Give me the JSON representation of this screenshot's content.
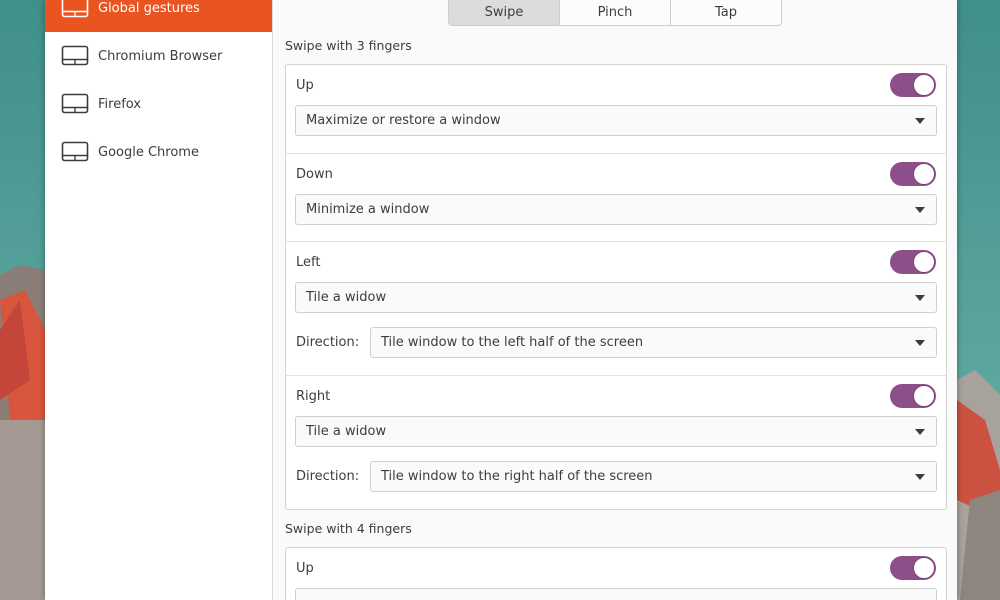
{
  "sidebar": {
    "items": [
      {
        "label": "Global gestures",
        "icon": "touchpad-icon",
        "active": true
      },
      {
        "label": "Chromium Browser",
        "icon": "touchpad-icon",
        "active": false
      },
      {
        "label": "Firefox",
        "icon": "touchpad-icon",
        "active": false
      },
      {
        "label": "Google Chrome",
        "icon": "touchpad-icon",
        "active": false
      }
    ]
  },
  "tabs": [
    {
      "label": "Swipe",
      "active": true
    },
    {
      "label": "Pinch",
      "active": false
    },
    {
      "label": "Tap",
      "active": false
    }
  ],
  "swipe3": {
    "title": "Swipe with 3 fingers",
    "gestures": [
      {
        "label": "Up",
        "enabled": true,
        "action": "Maximize or restore a window"
      },
      {
        "label": "Down",
        "enabled": true,
        "action": "Minimize a window"
      },
      {
        "label": "Left",
        "enabled": true,
        "action": "Tile a widow",
        "direction_label": "Direction:",
        "direction": "Tile window to the left half of the screen"
      },
      {
        "label": "Right",
        "enabled": true,
        "action": "Tile a widow",
        "direction_label": "Direction:",
        "direction": "Tile window to the right half of the screen"
      }
    ]
  },
  "swipe4": {
    "title": "Swipe with 4 fingers",
    "gestures": [
      {
        "label": "Up",
        "enabled": true
      }
    ]
  },
  "colors": {
    "accent": "#e95420",
    "toggle_on": "#8c4f8a"
  }
}
